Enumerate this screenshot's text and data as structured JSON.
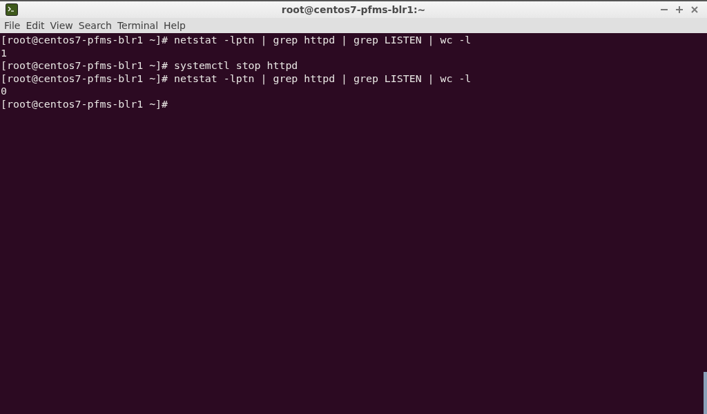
{
  "window": {
    "title": "root@centos7-pfms-blr1:~"
  },
  "menu": [
    "File",
    "Edit",
    "View",
    "Search",
    "Terminal",
    "Help"
  ],
  "terminal": {
    "lines": [
      "[root@centos7-pfms-blr1 ~]# netstat -lptn | grep httpd | grep LISTEN | wc -l",
      "1",
      "[root@centos7-pfms-blr1 ~]# systemctl stop httpd",
      "[root@centos7-pfms-blr1 ~]# netstat -lptn | grep httpd | grep LISTEN | wc -l",
      "0",
      "[root@centos7-pfms-blr1 ~]#"
    ]
  }
}
